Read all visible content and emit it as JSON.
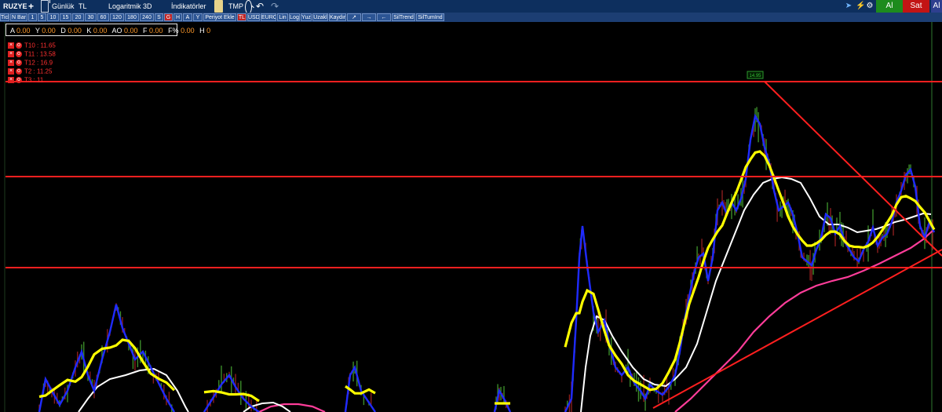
{
  "toolbar": {
    "symbol": "RUZYE",
    "add": "+",
    "period": "Günlük",
    "currency": "TL",
    "scale": "Logaritmik",
    "dimension": "3D",
    "indicators": "İndikatörler",
    "template": "TMP",
    "buy_label": "Al",
    "sell_label": "Sat",
    "extra_label": "Al"
  },
  "buttons": [
    {
      "label": "Tick",
      "active": false
    },
    {
      "label": "N Bar",
      "active": false
    },
    {
      "label": "1",
      "active": false
    },
    {
      "label": "5",
      "active": false
    },
    {
      "label": "10",
      "active": false
    },
    {
      "label": "15",
      "active": false
    },
    {
      "label": "20",
      "active": false
    },
    {
      "label": "30",
      "active": false
    },
    {
      "label": "60",
      "active": false
    },
    {
      "label": "120",
      "active": false
    },
    {
      "label": "180",
      "active": false
    },
    {
      "label": "240",
      "active": false
    },
    {
      "label": "S",
      "active": false
    },
    {
      "label": "G",
      "active": true
    },
    {
      "label": "H",
      "active": false
    },
    {
      "label": "A",
      "active": false
    },
    {
      "label": "Y",
      "active": false
    },
    {
      "label": "Periyot Ekle",
      "active": false
    },
    {
      "label": "TL",
      "active": true
    },
    {
      "label": "USD",
      "active": false
    },
    {
      "label": "EURO",
      "active": false
    },
    {
      "label": "Lin",
      "active": false
    },
    {
      "label": "Log",
      "active": false
    },
    {
      "label": "Yuz",
      "active": false
    },
    {
      "label": "Uzakl",
      "active": false
    },
    {
      "label": "Kaydır",
      "active": false
    },
    {
      "label": "",
      "active": false
    },
    {
      "label": "",
      "active": false
    },
    {
      "label": "",
      "active": false
    },
    {
      "label": "SilTrend",
      "active": false
    },
    {
      "label": "SilTumInd",
      "active": false
    }
  ],
  "info": {
    "A_label": "A",
    "A": "0.00",
    "Y_label": "Y",
    "Y": "0.00",
    "D_label": "D",
    "D": "0.00",
    "K_label": "K",
    "K": "0.00",
    "AO_label": "AO",
    "AO": "0.00",
    "F_label": "F",
    "F": "0.00",
    "Fp_label": "F%",
    "Fp": "0.00",
    "H_label": "H",
    "H": "0"
  },
  "targets": [
    {
      "label": "T10 : 11.65"
    },
    {
      "label": "T11 : 13.58"
    },
    {
      "label": "T12 : 16.9"
    },
    {
      "label": "T2 : 11.25"
    },
    {
      "label": "T3 : 11"
    }
  ],
  "chart_data": {
    "type": "line",
    "peak_label": "14.95",
    "horizontal_levels": [
      14.95,
      13.58,
      11.65
    ],
    "colors": {
      "background": "#000000",
      "price": "#1f2bff",
      "ma_fast": "#ffff00",
      "ma_mid": "#ffffff",
      "ma_slow": "#ff3d9a",
      "trend_lines": "#ff1f1f",
      "candle_up": "#3b8c2a",
      "candle_down": "#8b1e1e"
    }
  }
}
